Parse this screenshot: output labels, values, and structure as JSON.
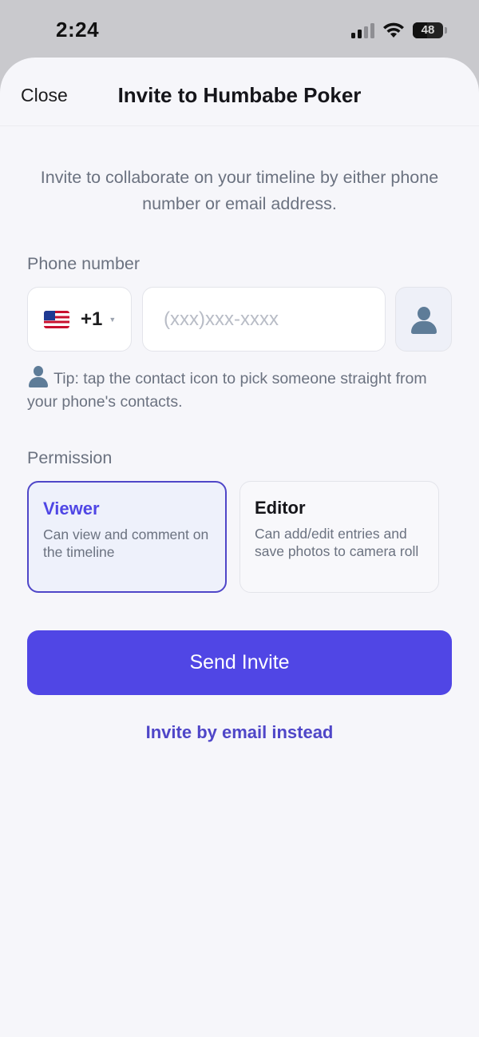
{
  "status_bar": {
    "time": "2:24",
    "battery": "48"
  },
  "nav": {
    "close_label": "Close",
    "title": "Invite to Humbabe Poker"
  },
  "intro_text": "Invite to collaborate on your timeline by either phone number or email address.",
  "phone": {
    "section_label": "Phone number",
    "country_flag": "us-flag",
    "country_code": "+1",
    "input_value": "",
    "input_placeholder": "(xxx)xxx-xxxx",
    "contact_icon": "person-icon"
  },
  "tip": "Tip: tap the contact icon to pick someone straight from your phone's contacts.",
  "permission": {
    "section_label": "Permission",
    "selected": "Viewer",
    "options": [
      {
        "title": "Viewer",
        "description": "Can view and comment on the timeline"
      },
      {
        "title": "Editor",
        "description": "Can add/edit entries and save photos to camera roll"
      }
    ]
  },
  "actions": {
    "send_label": "Send Invite",
    "email_link_label": "Invite by email instead"
  },
  "colors": {
    "accent": "#5046e5",
    "background": "#f6f6fa"
  }
}
